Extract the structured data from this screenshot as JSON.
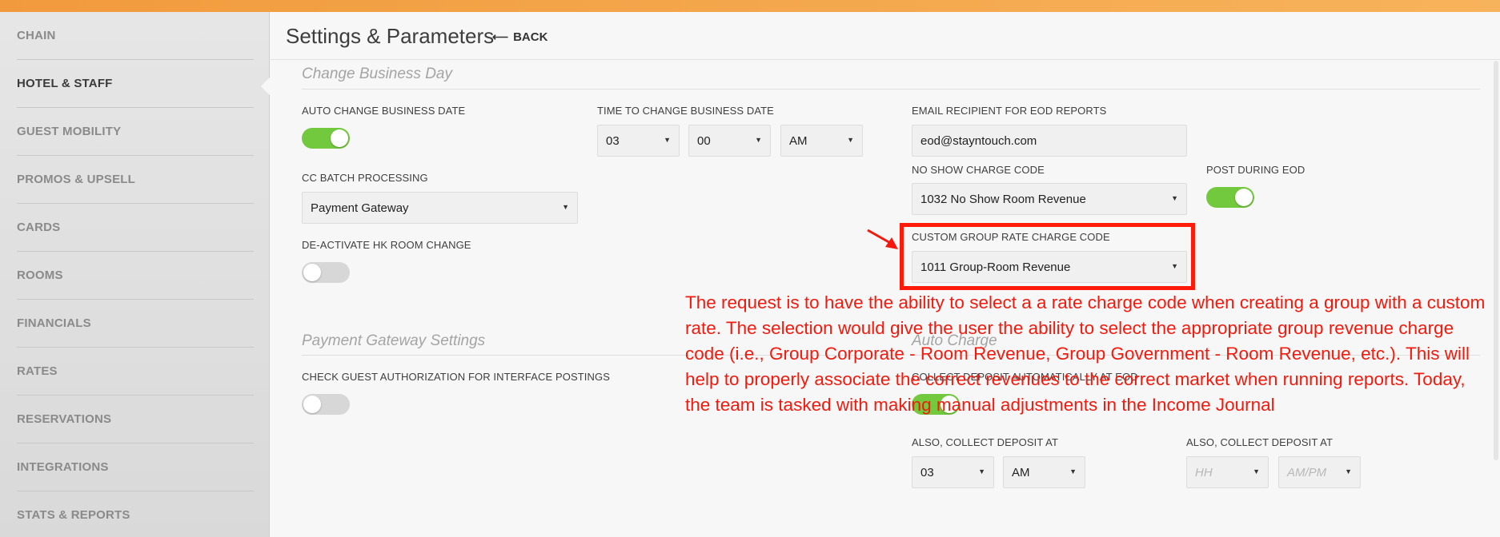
{
  "colors": {
    "accent_orange": "#f19a3d",
    "toggle_on": "#72c93e",
    "toggle_off": "#d7d7d7",
    "annotation_red": "#f4190c"
  },
  "sidebar": {
    "items": [
      {
        "label": "CHAIN"
      },
      {
        "label": "HOTEL & STAFF",
        "active": true
      },
      {
        "label": "GUEST MOBILITY"
      },
      {
        "label": "PROMOS & UPSELL"
      },
      {
        "label": "CARDS"
      },
      {
        "label": "ROOMS"
      },
      {
        "label": "FINANCIALS"
      },
      {
        "label": "RATES"
      },
      {
        "label": "RESERVATIONS"
      },
      {
        "label": "INTEGRATIONS"
      },
      {
        "label": "STATS & REPORTS"
      }
    ]
  },
  "header": {
    "title": "Settings & Parameters",
    "back_label": "BACK",
    "back_icon": "arrow-left-icon"
  },
  "change_business_day": {
    "section_title": "Change Business Day",
    "auto_change_label": "AUTO CHANGE BUSINESS DATE",
    "auto_change_on": true,
    "time_label": "TIME TO CHANGE BUSINESS DATE",
    "time_hour": "03",
    "time_minute": "00",
    "time_ampm": "AM",
    "cc_batch_label": "CC BATCH PROCESSING",
    "cc_batch_value": "Payment Gateway",
    "deactivate_hk_label": "DE-ACTIVATE HK ROOM CHANGE",
    "deactivate_hk_on": false,
    "email_label": "EMAIL RECIPIENT FOR EOD REPORTS",
    "email_value": "eod@stayntouch.com",
    "no_show_label": "NO SHOW CHARGE CODE",
    "no_show_value": "1032 No Show Room Revenue",
    "post_eod_label": "POST DURING EOD",
    "post_eod_on": true,
    "custom_group_label": "CUSTOM GROUP RATE CHARGE CODE",
    "custom_group_value": "1011 Group-Room Revenue"
  },
  "payment_gateway": {
    "section_title": "Payment Gateway Settings",
    "check_guest_label": "CHECK GUEST AUTHORIZATION FOR INTERFACE POSTINGS",
    "check_guest_on": false
  },
  "auto_charge": {
    "section_title": "Auto Charge",
    "collect_label": "COLLECT DEPOSIT AUTOMATICALLY AT EOD",
    "collect_on": true,
    "also_collect_label_1": "ALSO, COLLECT DEPOSIT AT",
    "also_collect_hour_1": "03",
    "also_collect_ampm_1": "AM",
    "also_collect_label_2": "ALSO, COLLECT DEPOSIT AT",
    "also_collect_hour_2_placeholder": "HH",
    "also_collect_ampm_2_placeholder": "AM/PM"
  },
  "annotation": {
    "text": "The request is to have the ability to select a a rate charge code when creating a group with a custom rate.  The selection would give the user the ability to select the appropriate group revenue charge code (i.e., Group Corporate - Room Revenue, Group Government - Room Revenue, etc.).  This will help to properly associate the correct revenues to the correct market when running reports.  Today, the team is tasked with making manual adjustments in the Income Journal"
  }
}
